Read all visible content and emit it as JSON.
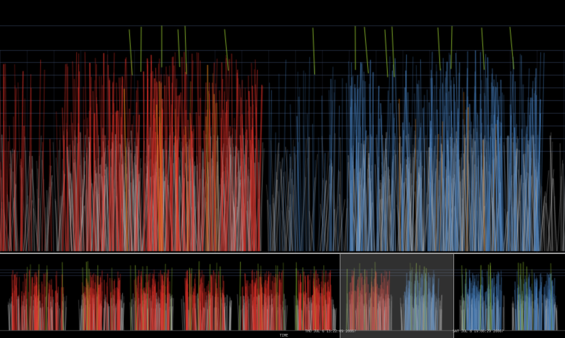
{
  "axis": {
    "title": "TIME",
    "start_label": "THU JUL  6 13:22:09 2006?",
    "end_label": "SAT JUL  8 19:06:29 2006?"
  },
  "colors": {
    "background": "#000000",
    "group_a": "#e8332a",
    "group_b": "#4a86c8",
    "baseline_traces": "#c8c8c8",
    "highlight_traces": "#8fbf2f",
    "accent_traces": "#e0801a",
    "gridline": "#3a4a6a",
    "brush": "#969696"
  }
}
